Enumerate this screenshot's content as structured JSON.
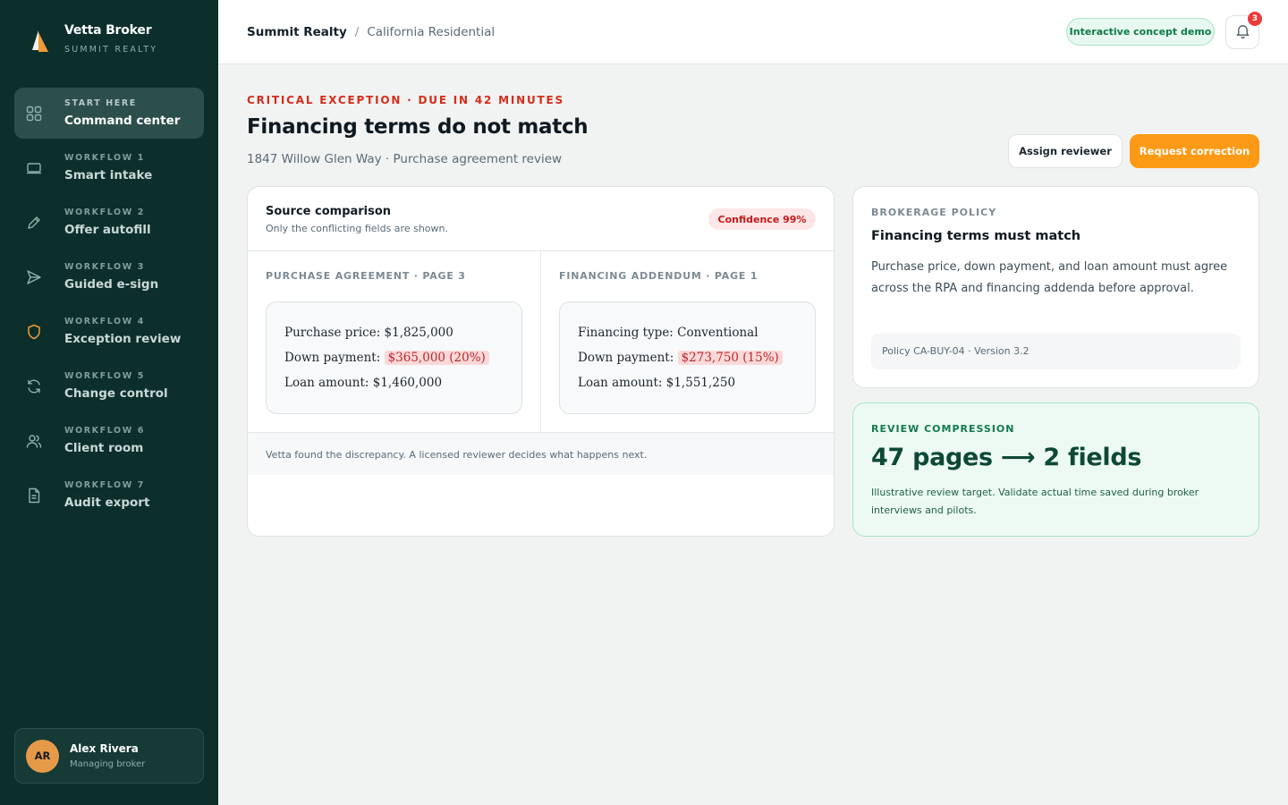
{
  "brand": {
    "name": "Vetta Broker",
    "sub": "SUMMIT REALTY"
  },
  "nav": [
    {
      "kicker": "START HERE",
      "label": "Command center",
      "icon": "grid-icon",
      "active": true
    },
    {
      "kicker": "WORKFLOW 1",
      "label": "Smart intake",
      "icon": "inbox-icon"
    },
    {
      "kicker": "WORKFLOW 2",
      "label": "Offer autofill",
      "icon": "pencil-icon"
    },
    {
      "kicker": "WORKFLOW 3",
      "label": "Guided e-sign",
      "icon": "send-icon"
    },
    {
      "kicker": "WORKFLOW 4",
      "label": "Exception review",
      "icon": "shield-icon"
    },
    {
      "kicker": "WORKFLOW 5",
      "label": "Change control",
      "icon": "refresh-icon"
    },
    {
      "kicker": "WORKFLOW 6",
      "label": "Client room",
      "icon": "users-icon"
    },
    {
      "kicker": "WORKFLOW 7",
      "label": "Audit export",
      "icon": "document-icon"
    }
  ],
  "user": {
    "initials": "AR",
    "name": "Alex Rivera",
    "role": "Managing broker"
  },
  "topbar": {
    "crumb_main": "Summit Realty",
    "crumb_sep": "/",
    "crumb_sub": "California Residential",
    "demo_badge": "Interactive concept demo",
    "notification_count": "3"
  },
  "header": {
    "kicker": "CRITICAL EXCEPTION · DUE IN 42 MINUTES",
    "title": "Financing terms do not match",
    "subtitle": "1847 Willow Glen Way · Purchase agreement review",
    "assign_label": "Assign reviewer",
    "correct_label": "Request correction"
  },
  "comparison": {
    "title": "Source comparison",
    "subtitle": "Only the conflicting fields are shown.",
    "confidence": "Confidence 99%",
    "left": {
      "title": "PURCHASE AGREEMENT · PAGE 3",
      "line1": "Purchase price: $1,825,000",
      "line2_label": "Down payment:",
      "line2_value": "$365,000 (20%)",
      "line3": "Loan amount: $1,460,000"
    },
    "right": {
      "title": "FINANCING ADDENDUM · PAGE 1",
      "line1": "Financing type: Conventional",
      "line2_label": "Down payment:",
      "line2_value": "$273,750 (15%)",
      "line3": "Loan amount: $1,551,250"
    },
    "footer": "Vetta found the discrepancy. A licensed reviewer decides what happens next."
  },
  "policy": {
    "kicker": "BROKERAGE POLICY",
    "title": "Financing terms must match",
    "body": "Purchase price, down payment, and loan amount must agree across the RPA and financing addenda before approval.",
    "ref": "Policy CA-BUY-04 · Version 3.2"
  },
  "compression": {
    "kicker": "REVIEW COMPRESSION",
    "headline": "47 pages ⟶ 2 fields",
    "note": "Illustrative review target. Validate actual time saved during broker interviews and pilots."
  },
  "colors": {
    "sidebar": "#0c2f2b",
    "accent": "#fc9a16",
    "critical": "#d62d1a",
    "success": "#127a4c"
  }
}
